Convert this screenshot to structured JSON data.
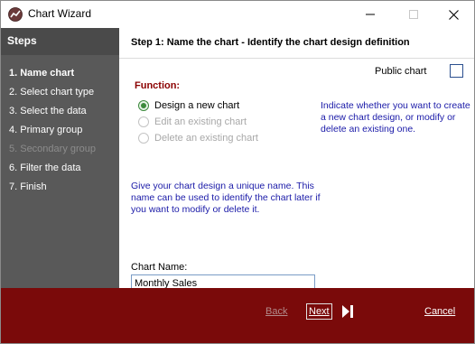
{
  "window": {
    "title": "Chart Wizard",
    "controls": [
      "minimize-icon",
      "maximize-icon",
      "close-icon"
    ]
  },
  "sidebar": {
    "header": "Steps",
    "steps": [
      {
        "label": "1. Name chart",
        "state": "active"
      },
      {
        "label": "2. Select chart type",
        "state": "normal"
      },
      {
        "label": "3. Select the data",
        "state": "normal"
      },
      {
        "label": "4. Primary group",
        "state": "normal"
      },
      {
        "label": "5. Secondary group",
        "state": "disabled"
      },
      {
        "label": "6. Filter the data",
        "state": "normal"
      },
      {
        "label": "7. Finish",
        "state": "normal"
      }
    ]
  },
  "main": {
    "header": "Step 1: Name the chart - Identify the chart design definition",
    "public_chart_label": "Public chart",
    "public_chart_checked": false,
    "function_label": "Function:",
    "functions": [
      {
        "label": "Design a new chart",
        "selected": true,
        "enabled": true
      },
      {
        "label": "Edit an existing chart",
        "selected": false,
        "enabled": false
      },
      {
        "label": "Delete an existing chart",
        "selected": false,
        "enabled": false
      }
    ],
    "function_help": "Indicate whether you want to create a new chart design, or modify or delete an existing one.",
    "name_help": "Give your chart design a unique name. This name can be used to identify the chart later if you want to modify or delete it.",
    "chart_name_label": "Chart Name:",
    "chart_name_value": "Monthly Sales"
  },
  "footer": {
    "back_label": "Back",
    "next_label": "Next",
    "finish_icon": "skip-to-end-icon",
    "cancel_label": "Cancel"
  },
  "colors": {
    "sidebar_bg": "#595959",
    "footer_bg": "#7a0a0a",
    "function_label": "#8b0000",
    "help_text": "#1a1aa8",
    "radio_selected": "#3c8a3c"
  }
}
